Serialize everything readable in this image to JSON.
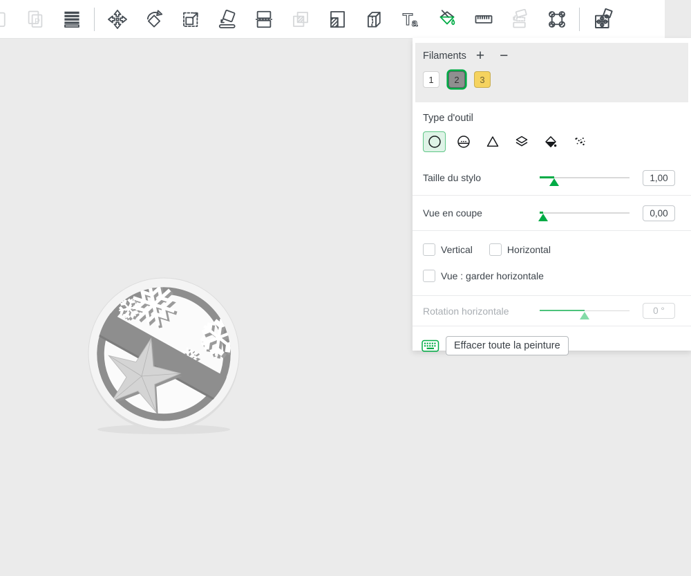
{
  "toolbar": {
    "icons": [
      "copy",
      "paste",
      "object-list",
      "move",
      "rotate",
      "scale",
      "place-on-face",
      "cut",
      "boolean",
      "support-paint",
      "seam",
      "text",
      "color-paint",
      "measure",
      "assembly",
      "corner-handles",
      "plugin-puzzle"
    ],
    "active_tool": "color-paint",
    "disabled_tools": [
      "copy",
      "paste",
      "boolean",
      "assembly"
    ],
    "text_tool_glyph_main": "T",
    "text_tool_glyph_sub": "a"
  },
  "panel": {
    "filaments": {
      "label": "Filaments",
      "add_label": "+",
      "remove_label": "−",
      "selected": "2",
      "items": [
        {
          "id": "1",
          "color": "#ffffff"
        },
        {
          "id": "2",
          "color": "#8f8f8f"
        },
        {
          "id": "3",
          "color": "#f5d35f"
        }
      ]
    },
    "tool_type": {
      "label": "Type d'outil",
      "selected": "circle",
      "tools": [
        "circle",
        "sphere",
        "triangle",
        "height-range",
        "fill",
        "gap-fill"
      ]
    },
    "pen_size": {
      "label": "Taille du stylo",
      "value": "1,00",
      "fill": "16%"
    },
    "section_view": {
      "label": "Vue en coupe",
      "value": "0,00",
      "fill": "4%"
    },
    "options": {
      "vertical": "Vertical",
      "horizontal": "Horizontal",
      "keep_view_horizontal": "Vue : garder horizontale"
    },
    "rotation": {
      "label": "Rotation horizontale",
      "value": "0 °",
      "fill": "50%",
      "disabled": true
    },
    "actions": {
      "clear_all": "Effacer toute la peinture"
    }
  },
  "colors": {
    "accent_green": "#00ab45",
    "tool_selected_bg": "#dff3e7",
    "panel_section_bg": "#ececec",
    "canvas_bg": "#ebebeb",
    "model_gray": "#8e8e8e"
  }
}
